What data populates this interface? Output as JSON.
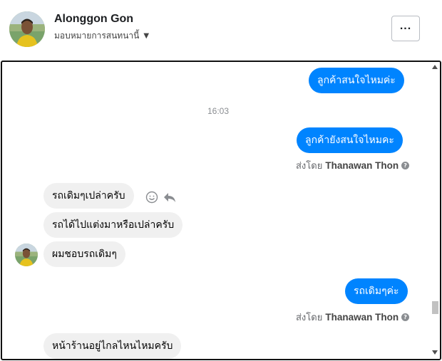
{
  "header": {
    "name": "Alonggon Gon",
    "assign_label": "มอบหมายการสนทนานี้",
    "more_label": "..."
  },
  "messages": {
    "out_1": "ลูกค้าสนใจไหมค่ะ",
    "timestamp": "16:03",
    "out_2": "ลูกค้ายังสนใจไหมคะ",
    "sent_by_prefix_1": "ส่งโดย",
    "sent_by_name_1": "Thanawan Thon",
    "in_1": "รถเดิมๆเปล่าครับ",
    "in_2": "รถได้ไปแต่งมาหรือเปล่าครับ",
    "in_3": "ผมชอบรถเดิมๆ",
    "out_3": "รถเดิมๆค่ะ",
    "sent_by_prefix_2": "ส่งโดย",
    "sent_by_name_2": "Thanawan Thon",
    "in_4": "หน้าร้านอยู่ไกลไหนไหมครับ"
  },
  "icons": {
    "react": "smiley-icon",
    "reply": "reply-icon",
    "help": "help-icon",
    "dropdown": "caret-down-icon"
  },
  "colors": {
    "outgoing_bubble": "#0084ff",
    "incoming_bubble": "#f0f0f0",
    "muted_text": "#65676b"
  }
}
